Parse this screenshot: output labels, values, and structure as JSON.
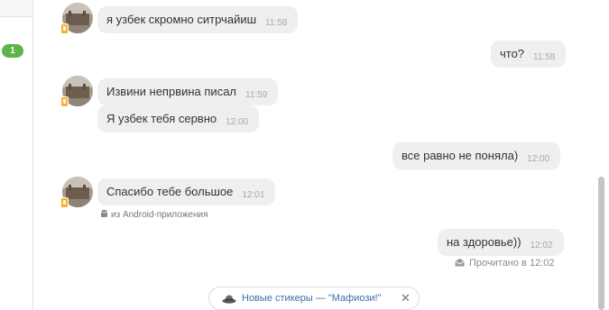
{
  "sidebar": {
    "unread_count": "1"
  },
  "messages": [
    {
      "text": "я узбек скромно ситрчайиш",
      "time": "11:58",
      "side": "in"
    },
    {
      "text": "что?",
      "time": "11:58",
      "side": "out"
    },
    {
      "text": "Извини непрвина писал",
      "time": "11:59",
      "side": "in"
    },
    {
      "text": "Я узбек тебя сервно",
      "time": "12:00",
      "side": "in"
    },
    {
      "text": "все равно не поняла)",
      "time": "12:00",
      "side": "out"
    },
    {
      "text": "Спасибо тебе большое",
      "time": "12:01",
      "side": "in"
    },
    {
      "text": "на здоровье))",
      "time": "12:02",
      "side": "out"
    }
  ],
  "source_note": "из Android-приложения",
  "read_status": "Прочитано в 12:02",
  "sticker_promo": {
    "text": "Новые стикеры — \"Мафиози!\"",
    "close": "✕"
  },
  "colors": {
    "bubble": "#efefef",
    "badge": "#5eb34a",
    "link": "#3f6ca8",
    "time": "#a9a9a9"
  },
  "icons": [
    "phone-icon",
    "android-icon",
    "read-envelope-icon",
    "sticker-icon",
    "close-icon"
  ]
}
